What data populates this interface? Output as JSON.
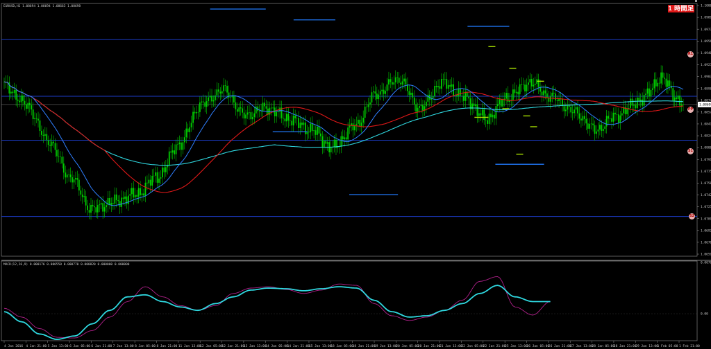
{
  "header": {
    "main_title": "EURUSD,H1  1.08694 1.08694 1.08663 1.08698",
    "macd_title": "MACD(12,26,9) 0.000176 0.000550 0.000770 0.000820 0.000000 0.000000",
    "badge": "1 時間足"
  },
  "pivot_badges": [
    "R1",
    "PP",
    "S1",
    "S2"
  ],
  "colors": {
    "background": "#000000",
    "candle": "#00d000",
    "ma_fast": "#2f7fff",
    "ma_mid": "#e01818",
    "ma_slow": "#2fd8e0",
    "macd_line": "#2fd8e0",
    "signal_line": "#b0208a",
    "level_line": "#1c3cc8",
    "segment_blue": "#1e6fe6",
    "segment_green": "#a8e000",
    "badge_bg": "#e01818"
  },
  "chart_data": [
    {
      "type": "candlestick",
      "symbol": "EURUSD",
      "timeframe": "H1",
      "y_ticks": [
        "1.10007",
        "1.09897",
        "1.09732",
        "1.09567",
        "1.09402",
        "1.09237",
        "1.09072",
        "1.08907",
        "1.08742",
        "1.08577",
        "1.08412",
        "1.08247",
        "1.08082",
        "1.07917",
        "1.07752",
        "1.07587",
        "1.07422",
        "1.07257",
        "1.07092",
        "1.06927",
        "1.06762",
        "1.06597"
      ],
      "x_ticks": [
        "4 Jan 2016",
        "4 Jan 21:00",
        "5 Jan 13:00",
        "6 Jan 05:00",
        "6 Jan 21:00",
        "7 Jan 13:00",
        "8 Jan 05:00",
        "8 Jan 21:00",
        "11 Jan 13:00",
        "12 Jan 05:00",
        "12 Jan 21:00",
        "13 Jan 13:00",
        "14 Jan 05:00",
        "14 Jan 21:00",
        "15 Jan 13:00",
        "18 Jan 05:00",
        "18 Jan 21:00",
        "19 Jan 13:00",
        "20 Jan 05:00",
        "20 Jan 21:00",
        "21 Jan 13:00",
        "22 Jan 05:00",
        "22 Jan 21:00",
        "25 Jan 13:00",
        "26 Jan 05:00",
        "26 Jan 21:00",
        "27 Jan 13:00",
        "28 Jan 05:00",
        "28 Jan 21:00",
        "29 Jan 13:00",
        "1 Feb 05:00",
        "1 Feb 21:00"
      ],
      "ylim": [
        1.06597,
        1.10097
      ],
      "current_price": 1.08698,
      "horizontal_levels": [
        1.09597,
        1.08812,
        1.08203,
        1.07147
      ],
      "close_path_approx": [
        {
          "t": 0,
          "y": 1.0896
        },
        {
          "t": 1,
          "y": 1.087
        },
        {
          "t": 2,
          "y": 1.082
        },
        {
          "t": 3,
          "y": 1.077
        },
        {
          "t": 4,
          "y": 1.0725
        },
        {
          "t": 5,
          "y": 1.0735
        },
        {
          "t": 6,
          "y": 1.0745
        },
        {
          "t": 7,
          "y": 1.077
        },
        {
          "t": 8,
          "y": 1.0815
        },
        {
          "t": 9,
          "y": 1.087
        },
        {
          "t": 10,
          "y": 1.089
        },
        {
          "t": 11,
          "y": 1.0855
        },
        {
          "t": 12,
          "y": 1.0865
        },
        {
          "t": 13,
          "y": 1.085
        },
        {
          "t": 14,
          "y": 1.0835
        },
        {
          "t": 15,
          "y": 1.081
        },
        {
          "t": 16,
          "y": 1.084
        },
        {
          "t": 17,
          "y": 1.0885
        },
        {
          "t": 18,
          "y": 1.0905
        },
        {
          "t": 19,
          "y": 1.0865
        },
        {
          "t": 20,
          "y": 1.09
        },
        {
          "t": 21,
          "y": 1.088
        },
        {
          "t": 22,
          "y": 1.085
        },
        {
          "t": 23,
          "y": 1.088
        },
        {
          "t": 24,
          "y": 1.09
        },
        {
          "t": 25,
          "y": 1.088
        },
        {
          "t": 26,
          "y": 1.086
        },
        {
          "t": 27,
          "y": 1.0835
        },
        {
          "t": 28,
          "y": 1.0855
        },
        {
          "t": 29,
          "y": 1.0875
        },
        {
          "t": 30,
          "y": 1.0905
        },
        {
          "t": 31,
          "y": 1.087
        }
      ]
    },
    {
      "type": "line",
      "title": "MACD(12,26,9)",
      "ylim": [
        -0.004,
        0.0076
      ],
      "y_ticks": [
        "0.0076",
        "0.00"
      ],
      "series": [
        {
          "name": "MACD",
          "values": [
            0.0003,
            -0.0012,
            -0.003,
            -0.0038,
            -0.0033,
            -0.0015,
            0.0005,
            0.0025,
            0.0028,
            0.0018,
            0.001,
            0.0005,
            0.0015,
            0.0025,
            0.0035,
            0.0038,
            0.0037,
            0.0034,
            0.0037,
            0.004,
            0.0038,
            0.002,
            0.0003,
            -0.0005,
            -0.0003,
            0.0005,
            0.0015,
            0.003,
            0.0042,
            0.0025,
            0.0018,
            0.0018
          ]
        },
        {
          "name": "Signal",
          "values": [
            0.0008,
            -0.0005,
            -0.0022,
            -0.0035,
            -0.0036,
            -0.0025,
            -0.0005,
            0.0018,
            0.004,
            0.0025,
            0.0012,
            0.0005,
            0.0012,
            0.003,
            0.0038,
            0.004,
            0.0036,
            0.003,
            0.0035,
            0.0044,
            0.0042,
            0.0015,
            -0.0003,
            -0.001,
            -0.0005,
            0.0005,
            0.002,
            0.0048,
            0.0055,
            0.001,
            -0.0002,
            0.0018
          ]
        }
      ]
    }
  ]
}
